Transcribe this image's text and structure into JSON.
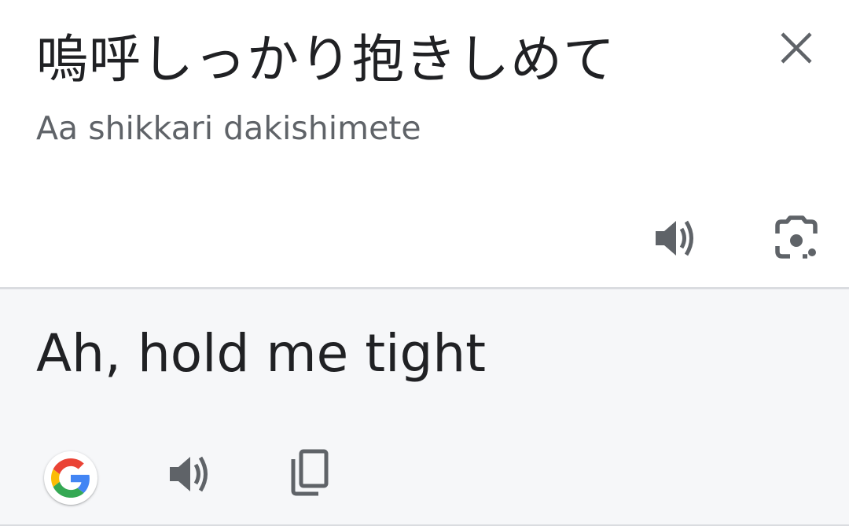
{
  "source": {
    "text": "嗚呼しっかり抱きしめて",
    "romanization": "Aa shikkari dakishimete",
    "icons": {
      "close": "close-icon",
      "speak": "speaker-icon",
      "lens": "lens-camera-icon"
    }
  },
  "result": {
    "text": "Ah, hold me tight",
    "icons": {
      "google": "google-g-icon",
      "speak": "speaker-icon",
      "copy": "copy-icon"
    }
  },
  "colors": {
    "source_background": "#ffffff",
    "result_background": "#f6f7f9",
    "primary_text": "#202124",
    "secondary_text": "#5f6368",
    "icon": "#5f6368",
    "divider": "#dadce0",
    "google_blue": "#4285F4",
    "google_red": "#EA4335",
    "google_yellow": "#FBBC05",
    "google_green": "#34A853"
  }
}
